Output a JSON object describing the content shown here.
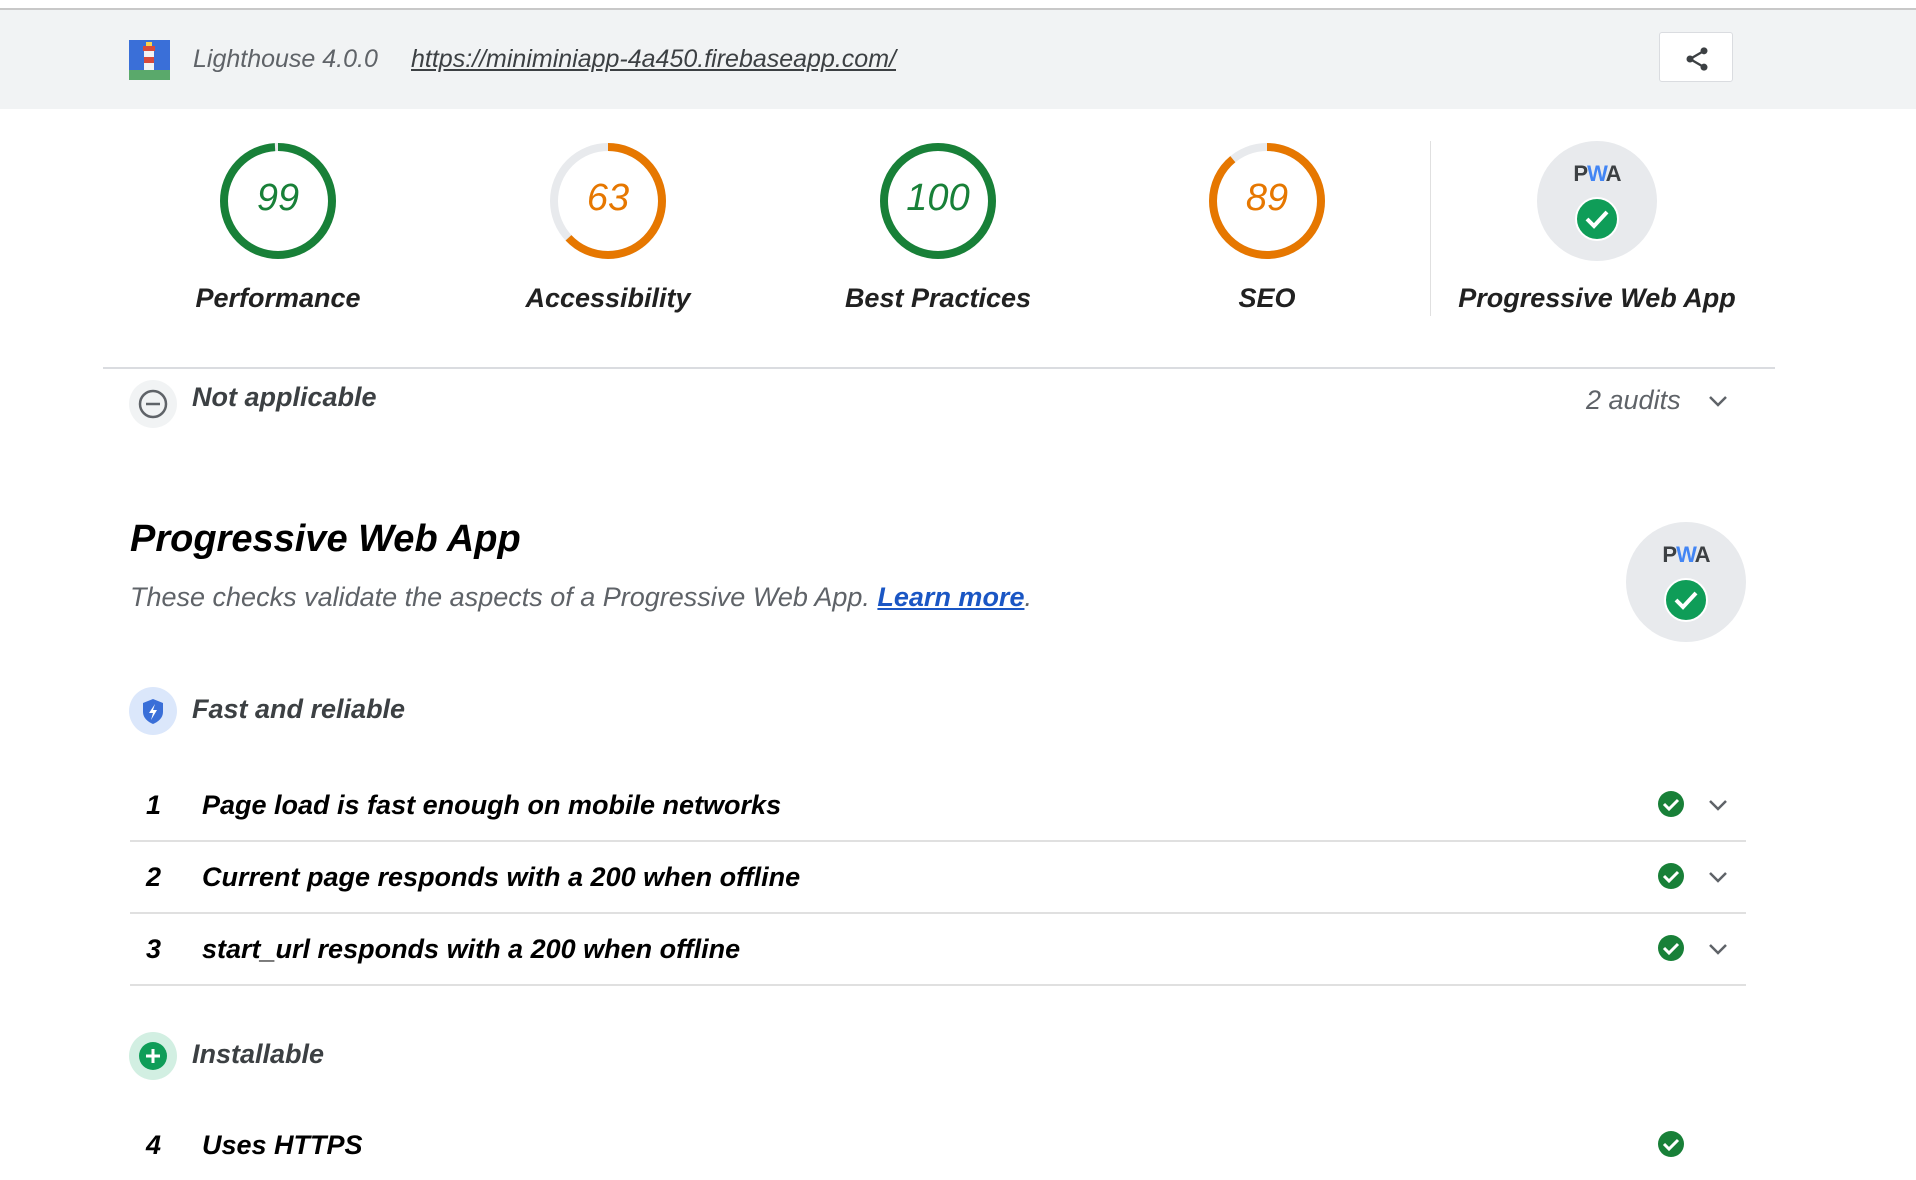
{
  "header": {
    "version": "Lighthouse 4.0.0",
    "url": "https://miniminiapp-4a450.firebaseapp.com/",
    "share_icon": "share-icon"
  },
  "gauges": [
    {
      "score": "99",
      "label": "Performance",
      "fraction": 0.99,
      "color": "#188038"
    },
    {
      "score": "63",
      "label": "Accessibility",
      "fraction": 0.63,
      "color": "#e67700"
    },
    {
      "score": "100",
      "label": "Best Practices",
      "fraction": 1.0,
      "color": "#188038"
    },
    {
      "score": "89",
      "label": "SEO",
      "fraction": 0.89,
      "color": "#e67700"
    }
  ],
  "pwa_gauge": {
    "label": "Progressive Web App",
    "badge_text_p": "P",
    "badge_text_w": "W",
    "badge_text_a": "A"
  },
  "not_applicable": {
    "label": "Not applicable",
    "count": "2 audits"
  },
  "section": {
    "title": "Progressive Web App",
    "description": "These checks validate the aspects of a Progressive Web App.",
    "learn_more": "Learn more",
    "period": "."
  },
  "groups": [
    {
      "label": "Fast and reliable",
      "icon": "lightning-shield-icon"
    },
    {
      "label": "Installable",
      "icon": "plus-icon"
    }
  ],
  "audits": [
    {
      "index": "1",
      "title": "Page load is fast enough on mobile networks"
    },
    {
      "index": "2",
      "title": "Current page responds with a 200 when offline"
    },
    {
      "index": "3",
      "title": "start_url responds with a 200 when offline"
    },
    {
      "index": "4",
      "title": "Uses HTTPS"
    }
  ],
  "colors": {
    "pass": "#188038",
    "average": "#e67700",
    "link": "#1a56c4"
  }
}
